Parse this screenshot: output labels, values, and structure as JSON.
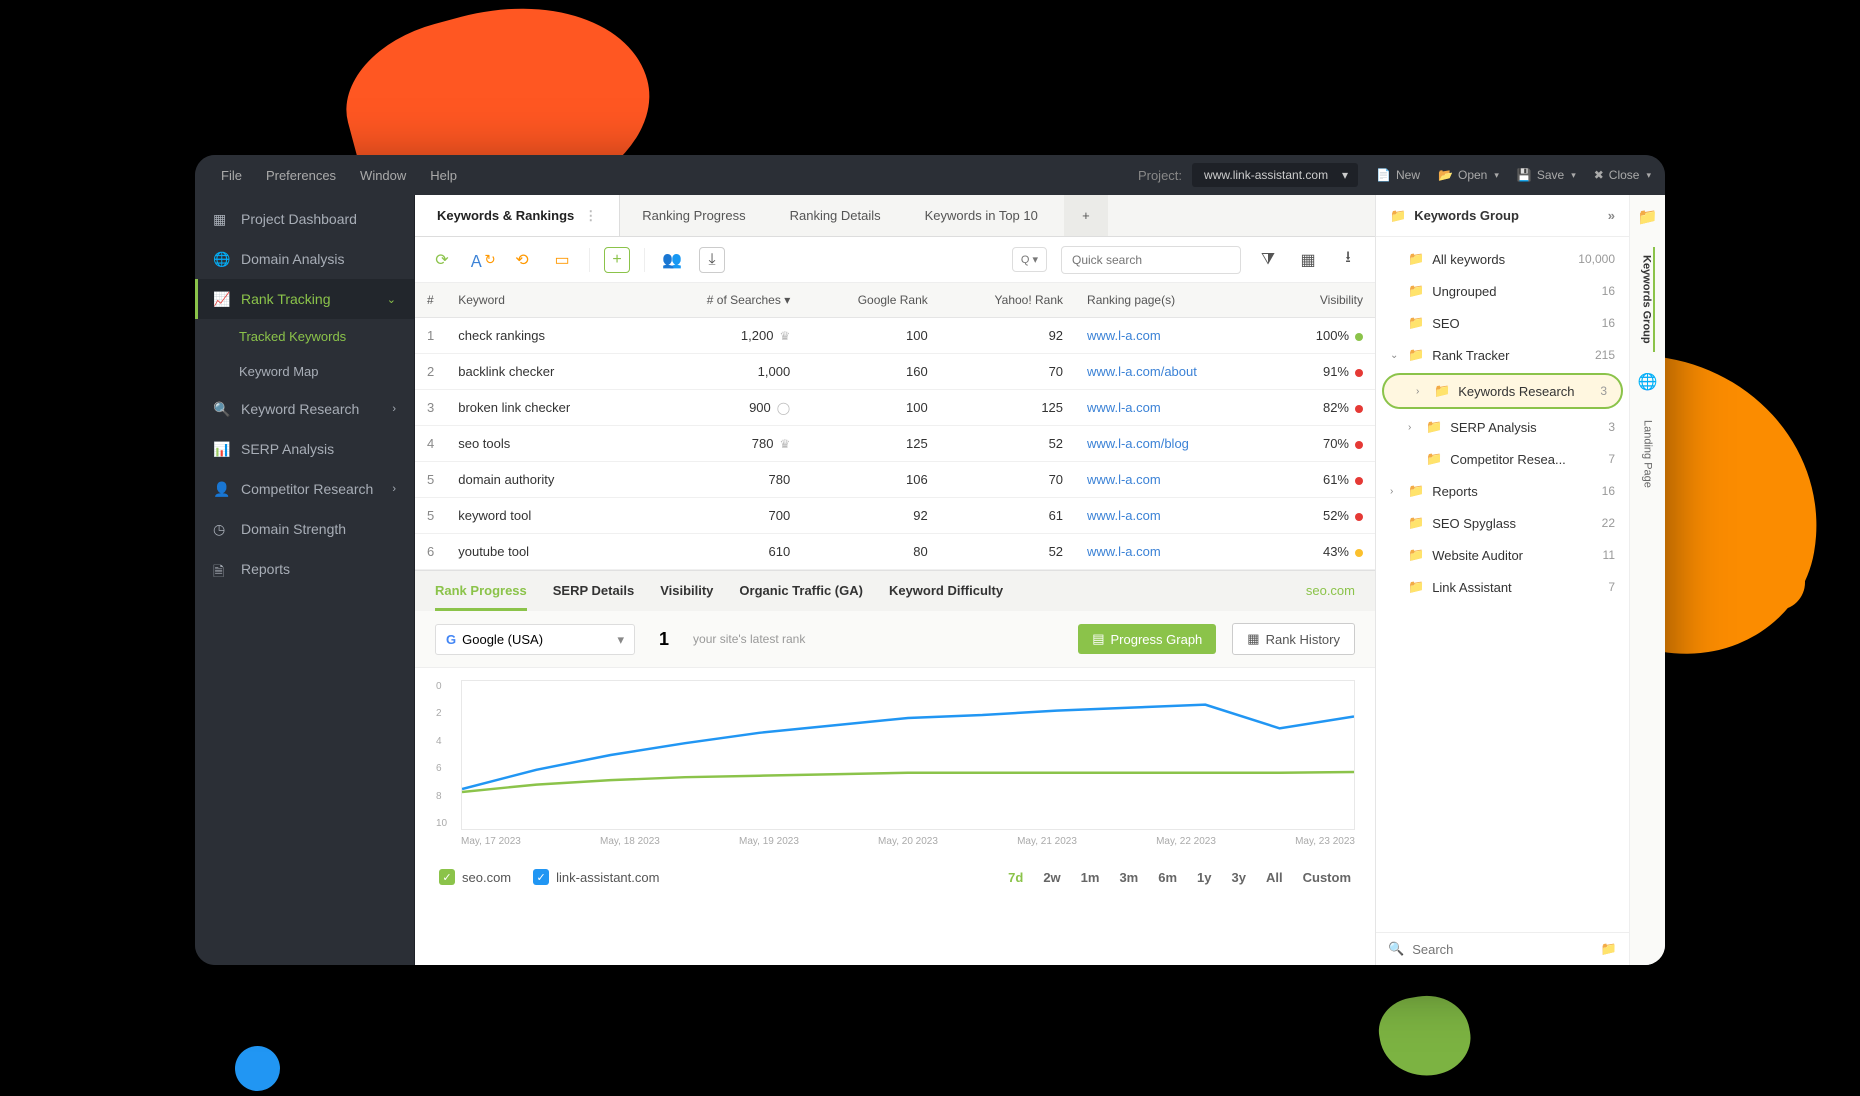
{
  "menubar": {
    "items": [
      "File",
      "Preferences",
      "Window",
      "Help"
    ],
    "project_label": "Project:",
    "project_value": "www.link-assistant.com",
    "buttons": {
      "new": "New",
      "open": "Open",
      "save": "Save",
      "close": "Close"
    }
  },
  "sidebar": {
    "dashboard": "Project Dashboard",
    "domain_analysis": "Domain Analysis",
    "rank_tracking": "Rank Tracking",
    "tracked_keywords": "Tracked Keywords",
    "keyword_map": "Keyword Map",
    "keyword_research": "Keyword Research",
    "serp_analysis": "SERP Analysis",
    "competitor_research": "Competitor Research",
    "domain_strength": "Domain Strength",
    "reports": "Reports"
  },
  "tabs": [
    "Keywords & Rankings",
    "Ranking Progress",
    "Ranking Details",
    "Keywords in Top 10"
  ],
  "search_placeholder": "Quick search",
  "q_label": "Q",
  "table": {
    "headers": {
      "idx": "#",
      "keyword": "Keyword",
      "searches": "# of Searches",
      "google": "Google Rank",
      "yahoo": "Yahoo! Rank",
      "pages": "Ranking page(s)",
      "visibility": "Visibility"
    },
    "rows": [
      {
        "idx": "1",
        "keyword": "check rankings",
        "searches": "1,200",
        "crown": true,
        "google": "100",
        "yahoo": "92",
        "page": "www.l-a.com",
        "vis": "100%",
        "dot": "green"
      },
      {
        "idx": "2",
        "keyword": "backlink checker",
        "searches": "1,000",
        "crown": false,
        "google": "160",
        "yahoo": "70",
        "page": "www.l-a.com/about",
        "vis": "91%",
        "dot": "red"
      },
      {
        "idx": "3",
        "keyword": "broken link checker",
        "searches": "900",
        "crown": false,
        "circ": true,
        "google": "100",
        "yahoo": "125",
        "page": "www.l-a.com",
        "vis": "82%",
        "dot": "red"
      },
      {
        "idx": "4",
        "keyword": "seo tools",
        "searches": "780",
        "crown": true,
        "google": "125",
        "yahoo": "52",
        "page": "www.l-a.com/blog",
        "vis": "70%",
        "dot": "red"
      },
      {
        "idx": "5",
        "keyword": "domain authority",
        "searches": "780",
        "crown": false,
        "google": "106",
        "yahoo": "70",
        "page": "www.l-a.com",
        "vis": "61%",
        "dot": "red"
      },
      {
        "idx": "5",
        "keyword": "keyword tool",
        "searches": "700",
        "crown": false,
        "google": "92",
        "yahoo": "61",
        "page": "www.l-a.com",
        "vis": "52%",
        "dot": "red"
      },
      {
        "idx": "6",
        "keyword": "youtube tool",
        "searches": "610",
        "crown": false,
        "google": "80",
        "yahoo": "52",
        "page": "www.l-a.com",
        "vis": "43%",
        "dot": "yellow"
      }
    ]
  },
  "detail_tabs": [
    "Rank Progress",
    "SERP Details",
    "Visibility",
    "Organic Traffic (GA)",
    "Keyword Difficulty"
  ],
  "detail_link": "seo.com",
  "engine": "Google (USA)",
  "rank_number": "1",
  "rank_hint": "your site's latest rank",
  "btn_progress": "Progress Graph",
  "btn_history": "Rank History",
  "chart_data": {
    "type": "line",
    "title": "",
    "xlabel": "",
    "ylabel": "",
    "ylim": [
      0,
      10
    ],
    "y_ticks": [
      "0",
      "2",
      "4",
      "6",
      "8",
      "10"
    ],
    "x_ticks": [
      "May, 17 2023",
      "May, 18 2023",
      "May, 19 2023",
      "May, 20 2023",
      "May, 21 2023",
      "May, 22 2023",
      "May, 23 2023"
    ],
    "series": [
      {
        "name": "seo.com",
        "color": "#8bc34a",
        "values": [
          7.5,
          7.0,
          6.7,
          6.5,
          6.4,
          6.3,
          6.2,
          6.2,
          6.2,
          6.2,
          6.2,
          6.2,
          6.15
        ]
      },
      {
        "name": "link-assistant.com",
        "color": "#2196f3",
        "values": [
          7.3,
          6.0,
          5.0,
          4.2,
          3.5,
          3.0,
          2.5,
          2.3,
          2.0,
          1.8,
          1.6,
          3.2,
          2.4
        ]
      }
    ]
  },
  "legend": {
    "seo": "seo.com",
    "la": "link-assistant.com"
  },
  "ranges": [
    "7d",
    "2w",
    "1m",
    "3m",
    "6m",
    "1y",
    "3y",
    "All",
    "Custom"
  ],
  "rightpanel": {
    "title": "Keywords Group",
    "items": [
      {
        "label": "All keywords",
        "count": "10,000",
        "folder": "dark",
        "indent": 0
      },
      {
        "label": "Ungrouped",
        "count": "16",
        "folder": "dark",
        "indent": 0
      },
      {
        "label": "SEO",
        "count": "16",
        "folder": "y",
        "indent": 0
      },
      {
        "label": "Rank Tracker",
        "count": "215",
        "folder": "y",
        "indent": 0,
        "exp": "v"
      },
      {
        "label": "Keywords Research",
        "count": "3",
        "folder": "y",
        "indent": 1,
        "exp": ">",
        "highlight": true
      },
      {
        "label": "SERP Analysis",
        "count": "3",
        "folder": "y",
        "indent": 1,
        "exp": ">"
      },
      {
        "label": "Competitor Resea...",
        "count": "7",
        "folder": "y",
        "indent": 1
      },
      {
        "label": "Reports",
        "count": "16",
        "folder": "y",
        "indent": 0,
        "exp": ">"
      },
      {
        "label": "SEO Spyglass",
        "count": "22",
        "folder": "y",
        "indent": 0
      },
      {
        "label": "Website Auditor",
        "count": "11",
        "folder": "y",
        "indent": 0
      },
      {
        "label": "Link Assistant",
        "count": "7",
        "folder": "y",
        "indent": 0
      }
    ],
    "search_placeholder": "Search",
    "vtabs": {
      "group": "Keywords Group",
      "landing": "Landing Page"
    }
  }
}
